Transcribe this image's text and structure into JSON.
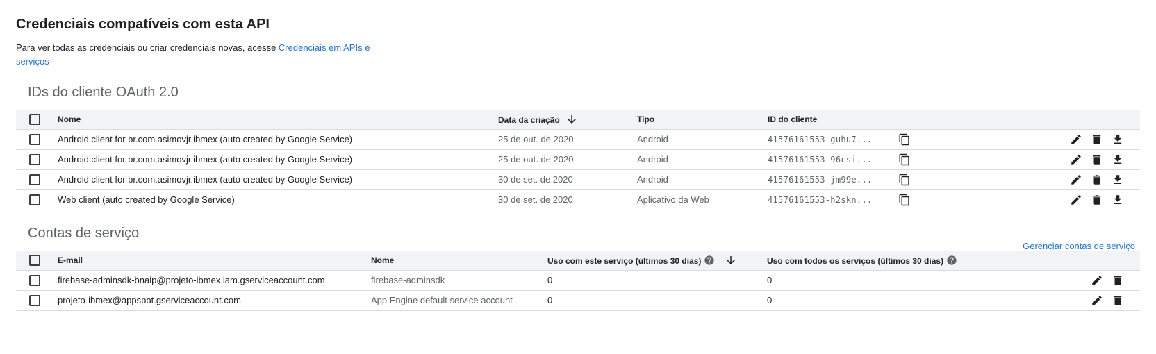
{
  "title": "Credenciais compatíveis com esta API",
  "intro": {
    "text": "Para ver todas as credenciais ou criar credenciais novas, acesse ",
    "link": "Credenciais em APIs e serviços"
  },
  "oauth": {
    "title": "IDs do cliente OAuth 2.0",
    "columns": {
      "name": "Nome",
      "date": "Data da criação",
      "type": "Tipo",
      "client_id": "ID do cliente"
    },
    "rows": [
      {
        "name": "Android client for br.com.asimovjr.ibmex (auto created by Google Service)",
        "date": "25 de out. de 2020",
        "type": "Android",
        "client_id": "41576161553-guhu7..."
      },
      {
        "name": "Android client for br.com.asimovjr.ibmex (auto created by Google Service)",
        "date": "25 de out. de 2020",
        "type": "Android",
        "client_id": "41576161553-96csi..."
      },
      {
        "name": "Android client for br.com.asimovjr.ibmex (auto created by Google Service)",
        "date": "30 de set. de 2020",
        "type": "Android",
        "client_id": "41576161553-jm99e..."
      },
      {
        "name": "Web client (auto created by Google Service)",
        "date": "30 de set. de 2020",
        "type": "Aplicativo da Web",
        "client_id": "41576161553-h2skn..."
      }
    ]
  },
  "service_accounts": {
    "title": "Contas de serviço",
    "manage_link": "Gerenciar contas de serviço",
    "columns": {
      "email": "E-mail",
      "name": "Nome",
      "usage_this": "Uso com este serviço (últimos 30 dias)",
      "usage_all": "Uso com todos os serviços (últimos 30 dias)"
    },
    "rows": [
      {
        "email": "firebase-adminsdk-bnaip@projeto-ibmex.iam.gserviceaccount.com",
        "name": "firebase-adminsdk",
        "usage_this": "0",
        "usage_all": "0"
      },
      {
        "email": "projeto-ibmex@appspot.gserviceaccount.com",
        "name": "App Engine default service account",
        "usage_this": "0",
        "usage_all": "0"
      }
    ]
  },
  "icons": {
    "checkbox": "checkbox-icon",
    "sort": "arrow-down-icon",
    "copy": "copy-icon",
    "edit": "pencil-icon",
    "delete": "trash-icon",
    "download": "download-icon",
    "help": "help-icon"
  },
  "colors": {
    "link": "#1a73e8",
    "header_bg": "#f1f3f4",
    "text": "#202124",
    "muted": "#5f6368"
  }
}
